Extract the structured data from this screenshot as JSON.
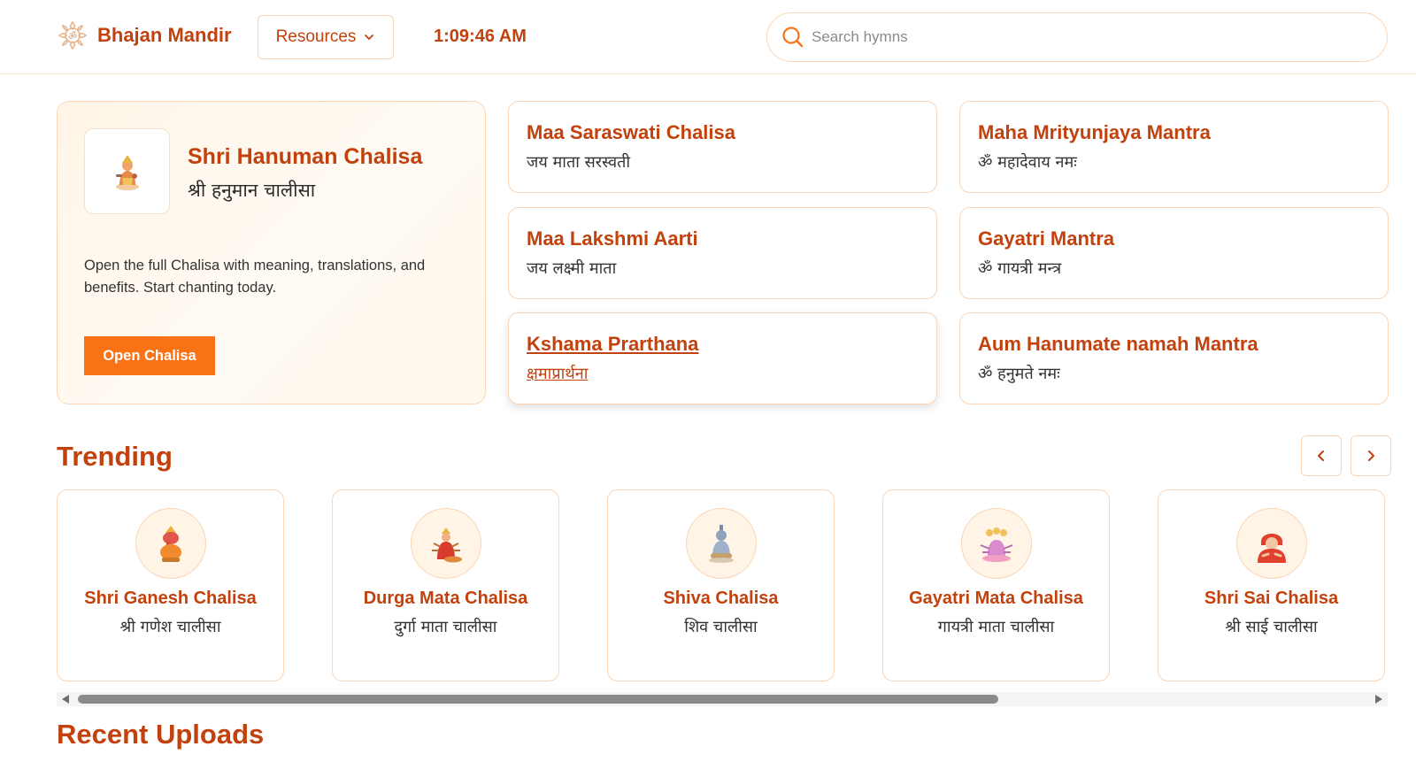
{
  "header": {
    "brand": "Bhajan Mandir",
    "resources_label": "Resources",
    "clock": "1:09:46 AM",
    "search_placeholder": "Search hymns"
  },
  "featured": {
    "title": "Shri Hanuman Chalisa",
    "subtitle": "श्री हनुमान चालीसा",
    "description": "Open the full Chalisa with meaning, translations, and benefits. Start chanting today.",
    "button": "Open Chalisa"
  },
  "grid": [
    {
      "title": "Maa Saraswati Chalisa",
      "subtitle": "जय माता सरस्वती"
    },
    {
      "title": "Maha Mrityunjaya Mantra",
      "subtitle": "ॐ महादेवाय नमः"
    },
    {
      "title": "Maa Lakshmi Aarti",
      "subtitle": "जय लक्ष्मी माता"
    },
    {
      "title": "Gayatri Mantra",
      "subtitle": "ॐ गायत्री मन्त्र"
    },
    {
      "title": "Kshama Prarthana",
      "subtitle": "क्षमाप्रार्थना"
    },
    {
      "title": "Aum Hanumate namah Mantra",
      "subtitle": "ॐ हनुमते नमः"
    }
  ],
  "trending": {
    "title": "Trending",
    "items": [
      {
        "title": "Shri Ganesh Chalisa",
        "subtitle": "श्री गणेश चालीसा"
      },
      {
        "title": "Durga Mata Chalisa",
        "subtitle": "दुर्गा माता चालीसा"
      },
      {
        "title": "Shiva Chalisa",
        "subtitle": "शिव चालीसा"
      },
      {
        "title": "Gayatri Mata Chalisa",
        "subtitle": "गायत्री माता चालीसा"
      },
      {
        "title": "Shri Sai Chalisa",
        "subtitle": "श्री साई चालीसा"
      }
    ]
  },
  "recent": {
    "title": "Recent Uploads"
  },
  "colors": {
    "accent": "#c2410c",
    "button": "#f97316",
    "border": "#fbd5b5"
  }
}
